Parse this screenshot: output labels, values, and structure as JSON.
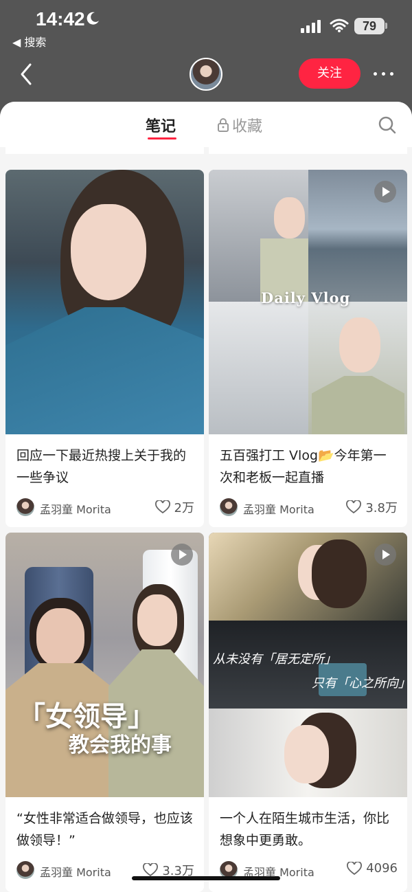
{
  "status_bar": {
    "time": "14:42",
    "back_app": "◀ 搜索",
    "battery": "79"
  },
  "header": {
    "follow_label": "关注"
  },
  "tabs": {
    "notes_label": "笔记",
    "favorites_label": "收藏"
  },
  "posts": [
    {
      "title": "回应一下最近热搜上关于我的一些争议",
      "author": "孟羽童 Morita",
      "likes": "2万",
      "is_video": false
    },
    {
      "title": "五百强打工 Vlog📂今年第一次和老板一起直播",
      "author": "孟羽童 Morita",
      "likes": "3.8万",
      "is_video": true,
      "overlay": "Daily Vlog"
    },
    {
      "title": "“女性非常适合做领导，也应该做领导！”",
      "author": "孟羽童 Morita",
      "likes": "3.3万",
      "is_video": true,
      "overlay_line1": "「女领导」",
      "overlay_line2": "教会我的事"
    },
    {
      "title": "一个人在陌生城市生活，你比想象中更勇敢。",
      "author": "孟羽童 Morita",
      "likes": "4096",
      "is_video": true,
      "overlay_line1": "从未没有「居无定所」",
      "overlay_line2": "只有「心之所向」"
    }
  ],
  "colors": {
    "accent": "#ff2442",
    "header_bg": "#555555",
    "page_bg": "#f5f5f5"
  }
}
